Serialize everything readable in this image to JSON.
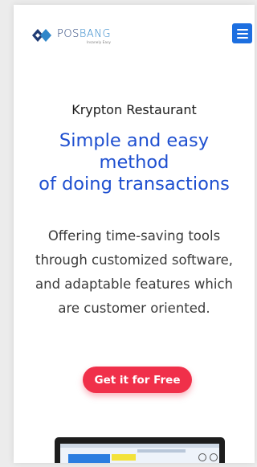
{
  "header": {
    "logo": {
      "brand": "POSBANG",
      "brand_pos": "POS",
      "brand_bang": "BANG",
      "tagline": "Insanely Easy"
    },
    "menu_icon": "hamburger-icon"
  },
  "hero": {
    "subtitle": "Krypton Restaurant",
    "headline_lines": [
      "Simple and easy",
      "method",
      "of doing transactions"
    ],
    "description_lines": [
      "Offering time-saving tools",
      "through customized software,",
      "and adaptable features which",
      "are customer oriented."
    ],
    "cta_label": "Get it for Free"
  },
  "colors": {
    "accent": "#1e4fd0",
    "menu_button": "#1d6fe0",
    "cta": "#f0304a"
  }
}
